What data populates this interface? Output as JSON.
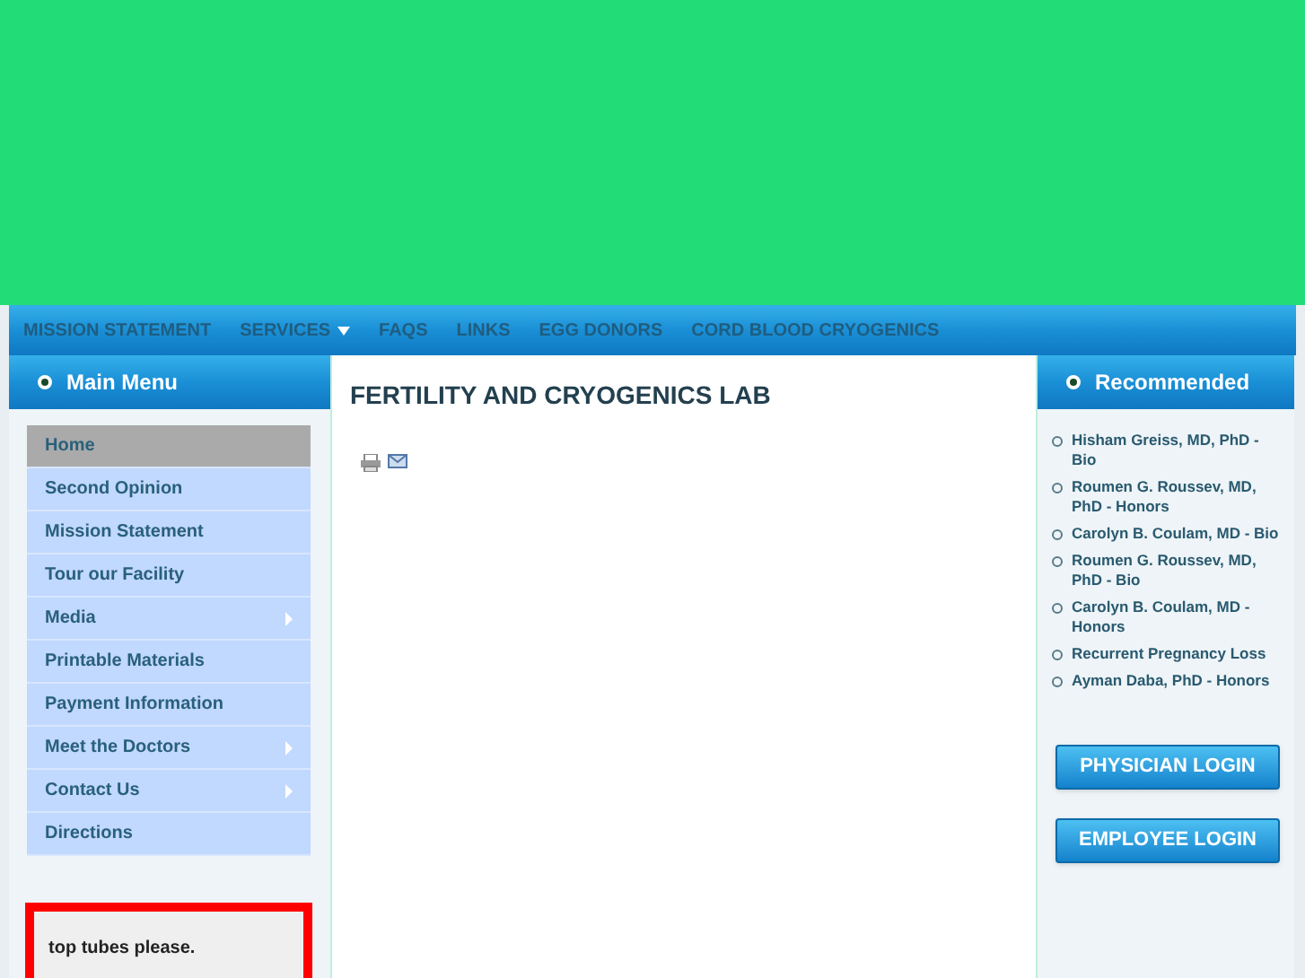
{
  "nav": [
    {
      "label": "MISSION STATEMENT",
      "has_submenu": false
    },
    {
      "label": "SERVICES",
      "has_submenu": true
    },
    {
      "label": "FAQS",
      "has_submenu": false
    },
    {
      "label": "LINKS",
      "has_submenu": false
    },
    {
      "label": "EGG DONORS",
      "has_submenu": false
    },
    {
      "label": "CORD BLOOD CRYOGENICS",
      "has_submenu": false
    }
  ],
  "main_menu": {
    "title": "Main Menu",
    "items": [
      {
        "label": "Home",
        "selected": true,
        "has_submenu": false
      },
      {
        "label": "Second Opinion",
        "selected": false,
        "has_submenu": false
      },
      {
        "label": "Mission Statement",
        "selected": false,
        "has_submenu": false
      },
      {
        "label": "Tour our Facility",
        "selected": false,
        "has_submenu": false
      },
      {
        "label": "Media",
        "selected": false,
        "has_submenu": true
      },
      {
        "label": "Printable Materials",
        "selected": false,
        "has_submenu": false
      },
      {
        "label": "Payment Information",
        "selected": false,
        "has_submenu": false
      },
      {
        "label": "Meet the Doctors",
        "selected": false,
        "has_submenu": true
      },
      {
        "label": "Contact Us",
        "selected": false,
        "has_submenu": true
      },
      {
        "label": "Directions",
        "selected": false,
        "has_submenu": false
      }
    ]
  },
  "notice": {
    "text": "top tubes please."
  },
  "content": {
    "title": "FERTILITY AND CRYOGENICS LAB"
  },
  "recommended": {
    "title": "Recommended",
    "items": [
      "Hisham Greiss, MD, PhD - Bio",
      "Roumen G. Roussev, MD, PhD - Honors",
      "Carolyn B. Coulam, MD - Bio",
      "Roumen G. Roussev, MD, PhD - Bio",
      "Carolyn B. Coulam, MD - Honors",
      "Recurrent Pregnancy Loss",
      "Ayman Daba, PhD - Honors"
    ]
  },
  "login_buttons": [
    "PHYSICIAN LOGIN",
    "EMPLOYEE LOGIN"
  ]
}
